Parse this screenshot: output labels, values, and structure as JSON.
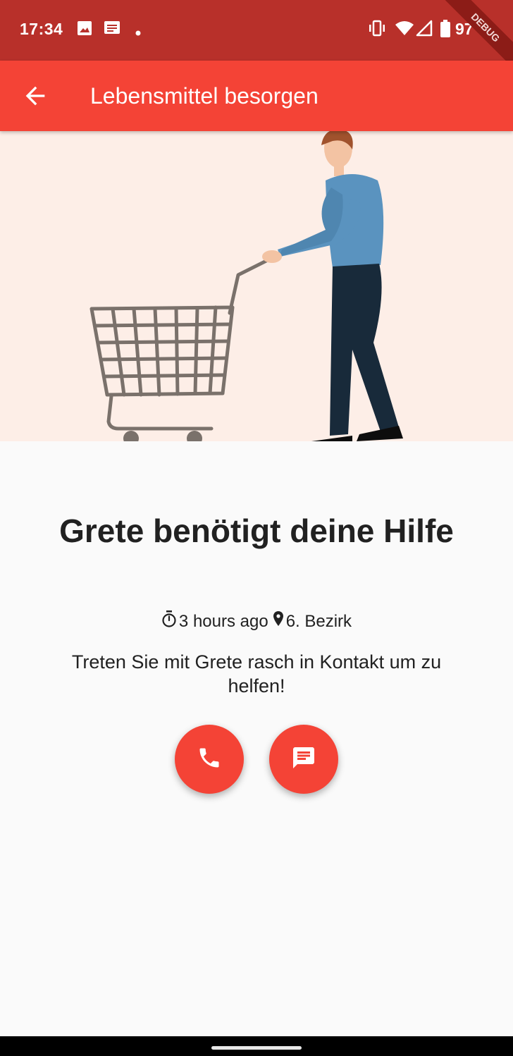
{
  "status_bar": {
    "time": "17:34",
    "battery": "97",
    "debug_label": "DEBUG",
    "icons": [
      "image-icon",
      "message-icon",
      "dot-icon",
      "vibrate-icon",
      "wifi-icon",
      "signal-icon",
      "battery-icon"
    ]
  },
  "app_bar": {
    "title": "Lebensmittel besorgen",
    "back_icon": "arrow-back-icon"
  },
  "hero": {
    "illustration": "man-with-shopping-cart"
  },
  "request": {
    "headline": "Grete benötigt deine Hilfe",
    "time_icon": "timer-icon",
    "time_ago": "3 hours ago",
    "location_icon": "location-pin-icon",
    "location": "6. Bezirk",
    "description": "Treten Sie mit Grete rasch in Kontakt um zu helfen!"
  },
  "actions": [
    {
      "name": "call",
      "icon": "phone-icon"
    },
    {
      "name": "message",
      "icon": "chat-icon"
    }
  ],
  "colors": {
    "status_bar": "#b8302a",
    "primary": "#f44336",
    "hero_background": "#fdeee7",
    "background": "#fafafa",
    "text": "#212121"
  }
}
